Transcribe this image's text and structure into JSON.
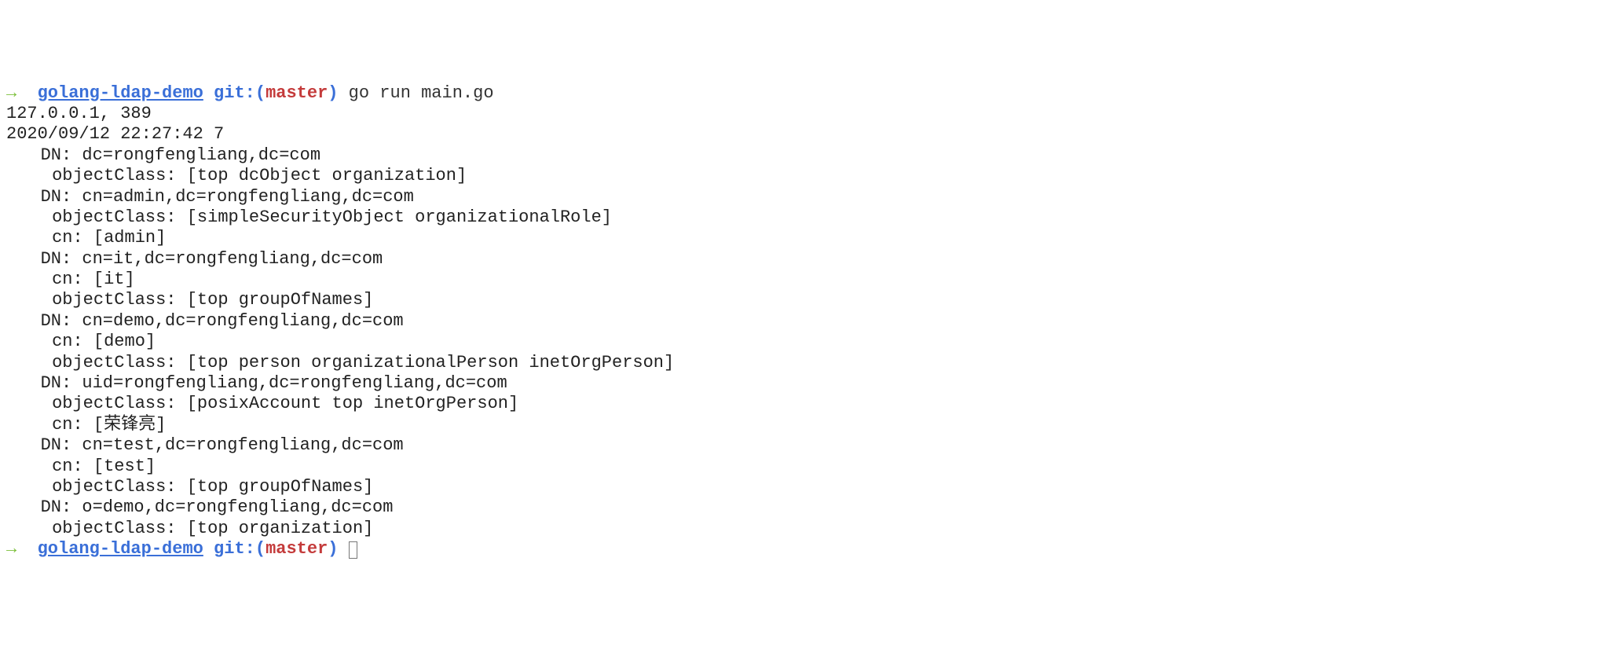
{
  "prompt1": {
    "arrow": "→",
    "dir": "golang-ldap-demo",
    "git_label": "git:",
    "paren_open": "(",
    "branch": "master",
    "paren_close": ")",
    "command": " go run main.go"
  },
  "out": {
    "line1": "127.0.0.1, 389",
    "line2": "2020/09/12 22:27:42 7",
    "entries": [
      {
        "dn": "DN: dc=rongfengliang,dc=com",
        "attrs": [
          "objectClass: [top dcObject organization]"
        ]
      },
      {
        "dn": "DN: cn=admin,dc=rongfengliang,dc=com",
        "attrs": [
          "objectClass: [simpleSecurityObject organizationalRole]",
          "cn: [admin]"
        ]
      },
      {
        "dn": "DN: cn=it,dc=rongfengliang,dc=com",
        "attrs": [
          "cn: [it]",
          "objectClass: [top groupOfNames]"
        ]
      },
      {
        "dn": "DN: cn=demo,dc=rongfengliang,dc=com",
        "attrs": [
          "cn: [demo]",
          "objectClass: [top person organizationalPerson inetOrgPerson]"
        ]
      },
      {
        "dn": "DN: uid=rongfengliang,dc=rongfengliang,dc=com",
        "attrs": [
          "objectClass: [posixAccount top inetOrgPerson]",
          "cn: [荣锋亮]"
        ]
      },
      {
        "dn": "DN: cn=test,dc=rongfengliang,dc=com",
        "attrs": [
          "cn: [test]",
          "objectClass: [top groupOfNames]"
        ]
      },
      {
        "dn": "DN: o=demo,dc=rongfengliang,dc=com",
        "attrs": [
          "objectClass: [top organization]"
        ]
      }
    ]
  },
  "prompt2": {
    "arrow": "→",
    "dir": "golang-ldap-demo",
    "git_label": "git:",
    "paren_open": "(",
    "branch": "master",
    "paren_close": ")"
  }
}
